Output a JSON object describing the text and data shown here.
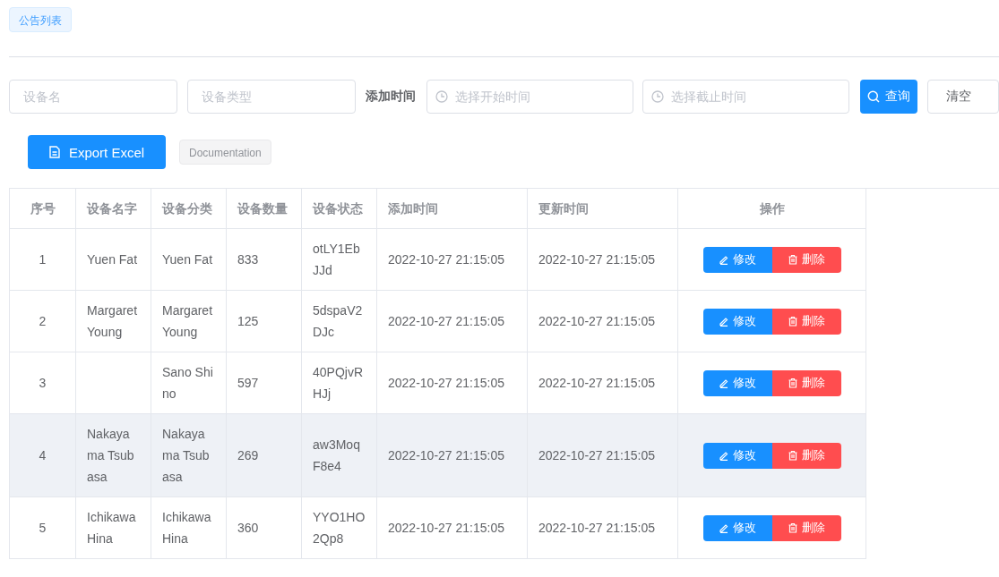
{
  "tag": "公告列表",
  "filters": {
    "name_placeholder": "设备名",
    "type_placeholder": "设备类型",
    "time_label": "添加时间",
    "start_placeholder": "选择开始时间",
    "end_placeholder": "选择截止时间",
    "search_button": "查询",
    "clear_button": "清空"
  },
  "toolbar": {
    "export_button": "Export Excel",
    "doc_button": "Documentation"
  },
  "table": {
    "columns": [
      "序号",
      "设备名字",
      "设备分类",
      "设备数量",
      "设备状态",
      "添加时间",
      "更新时间",
      "操作"
    ],
    "rows": [
      {
        "index": "1",
        "name": "Yuen Fat",
        "category": "Yuen Fat",
        "count": "833",
        "status": "otLY1EbJJd",
        "added": "2022-10-27 21:15:05",
        "updated": "2022-10-27 21:15:05",
        "edit": "修改",
        "delete": "删除",
        "highlighted": false
      },
      {
        "index": "2",
        "name": "Margaret Young",
        "category": "Margaret Young",
        "count": "125",
        "status": "5dspaV2DJc",
        "added": "2022-10-27 21:15:05",
        "updated": "2022-10-27 21:15:05",
        "edit": "修改",
        "delete": "删除",
        "highlighted": false
      },
      {
        "index": "3",
        "category": "Sano Shino",
        "count": "597",
        "status": "40PQjvRHJj",
        "added": "2022-10-27 21:15:05",
        "updated": "2022-10-27 21:15:05",
        "edit": "修改",
        "delete": "删除",
        "highlighted": false
      },
      {
        "index": "4",
        "name": "Nakayama Tsubasa",
        "category": "Nakayama Tsubasa",
        "count": "269",
        "status": "aw3MoqF8e4",
        "added": "2022-10-27 21:15:05",
        "updated": "2022-10-27 21:15:05",
        "edit": "修改",
        "delete": "删除",
        "highlighted": true
      },
      {
        "index": "5",
        "name": "Ichikawa Hina",
        "category": "Ichikawa Hina",
        "count": "360",
        "status": "YYO1HO2Qp8",
        "added": "2022-10-27 21:15:05",
        "updated": "2022-10-27 21:15:05",
        "edit": "修改",
        "delete": "删除",
        "highlighted": false
      }
    ]
  }
}
